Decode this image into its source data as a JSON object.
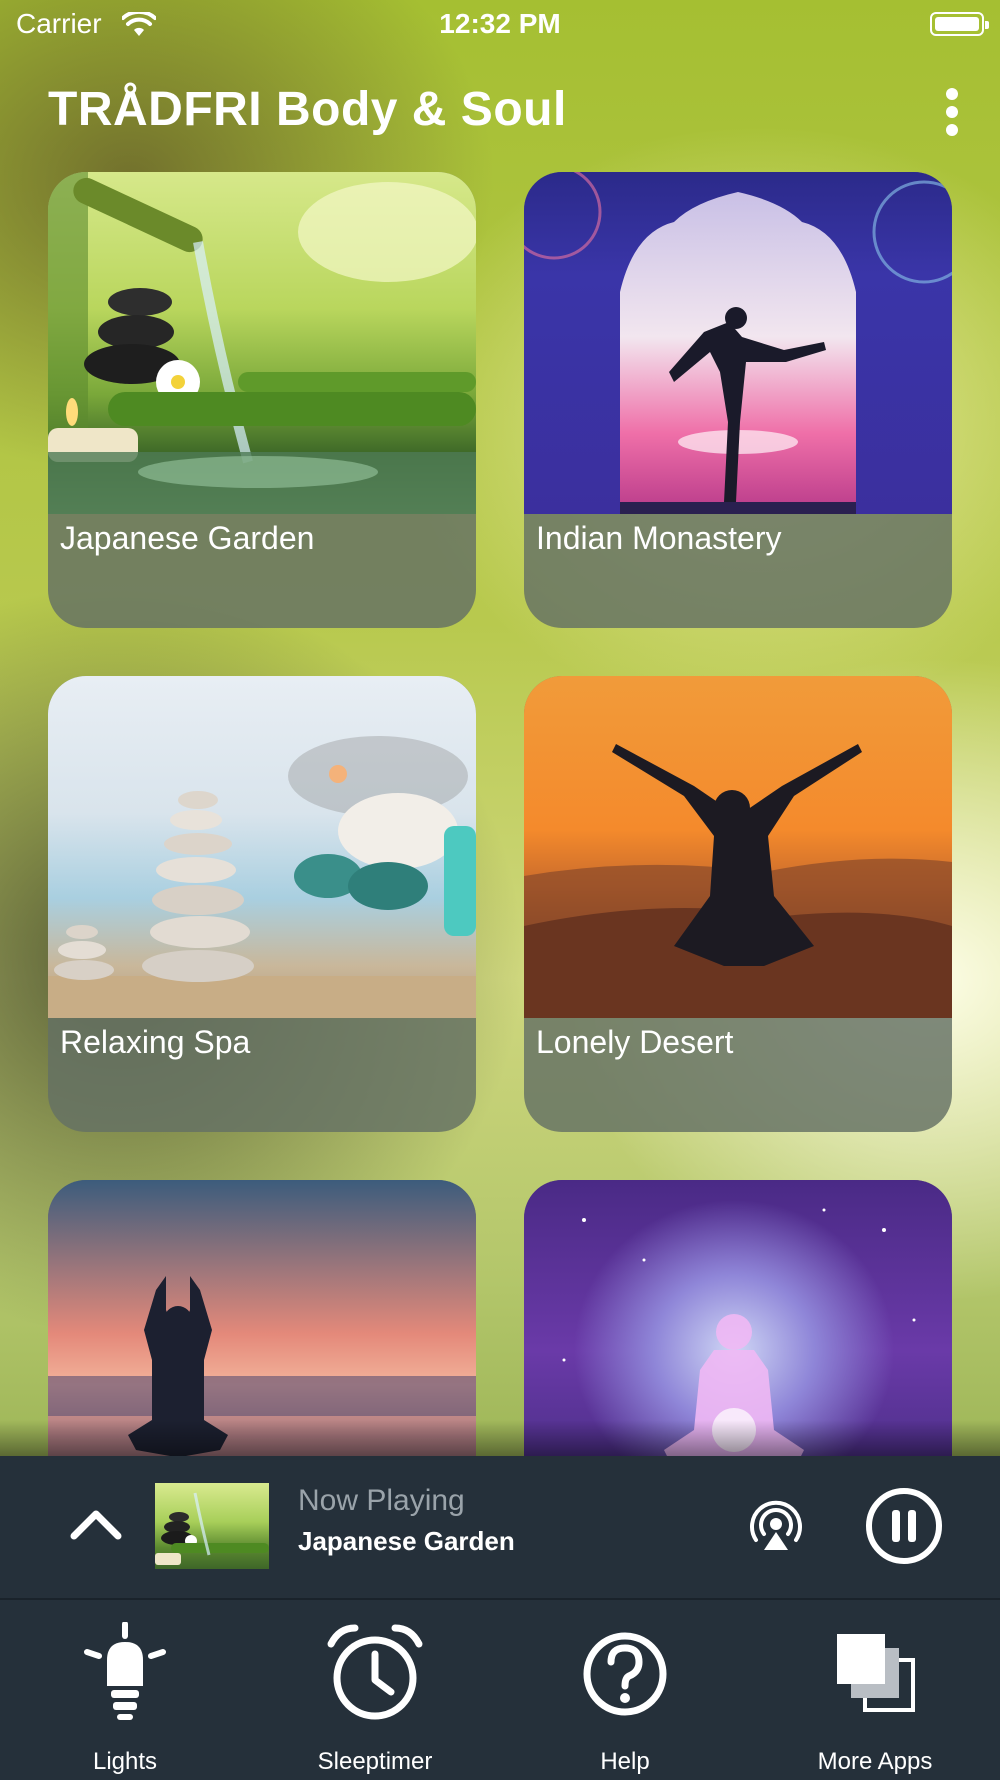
{
  "status_bar": {
    "carrier": "Carrier",
    "time": "12:32 PM"
  },
  "header": {
    "title": "TRÅDFRI Body & Soul"
  },
  "scenes": [
    {
      "label": "Japanese Garden"
    },
    {
      "label": "Indian Monastery"
    },
    {
      "label": "Relaxing Spa"
    },
    {
      "label": "Lonely Desert"
    },
    {
      "label": ""
    },
    {
      "label": ""
    }
  ],
  "now_playing": {
    "caption": "Now Playing",
    "title": "Japanese Garden"
  },
  "tabs": [
    {
      "label": "Lights",
      "icon": "bulb-icon"
    },
    {
      "label": "Sleeptimer",
      "icon": "alarm-clock-icon"
    },
    {
      "label": "Help",
      "icon": "question-icon"
    },
    {
      "label": "More Apps",
      "icon": "stacked-squares-icon"
    }
  ],
  "colors": {
    "bar_background": "#25303a",
    "card_label_background": "#64706a",
    "caption_gray": "#9aa3aa"
  }
}
